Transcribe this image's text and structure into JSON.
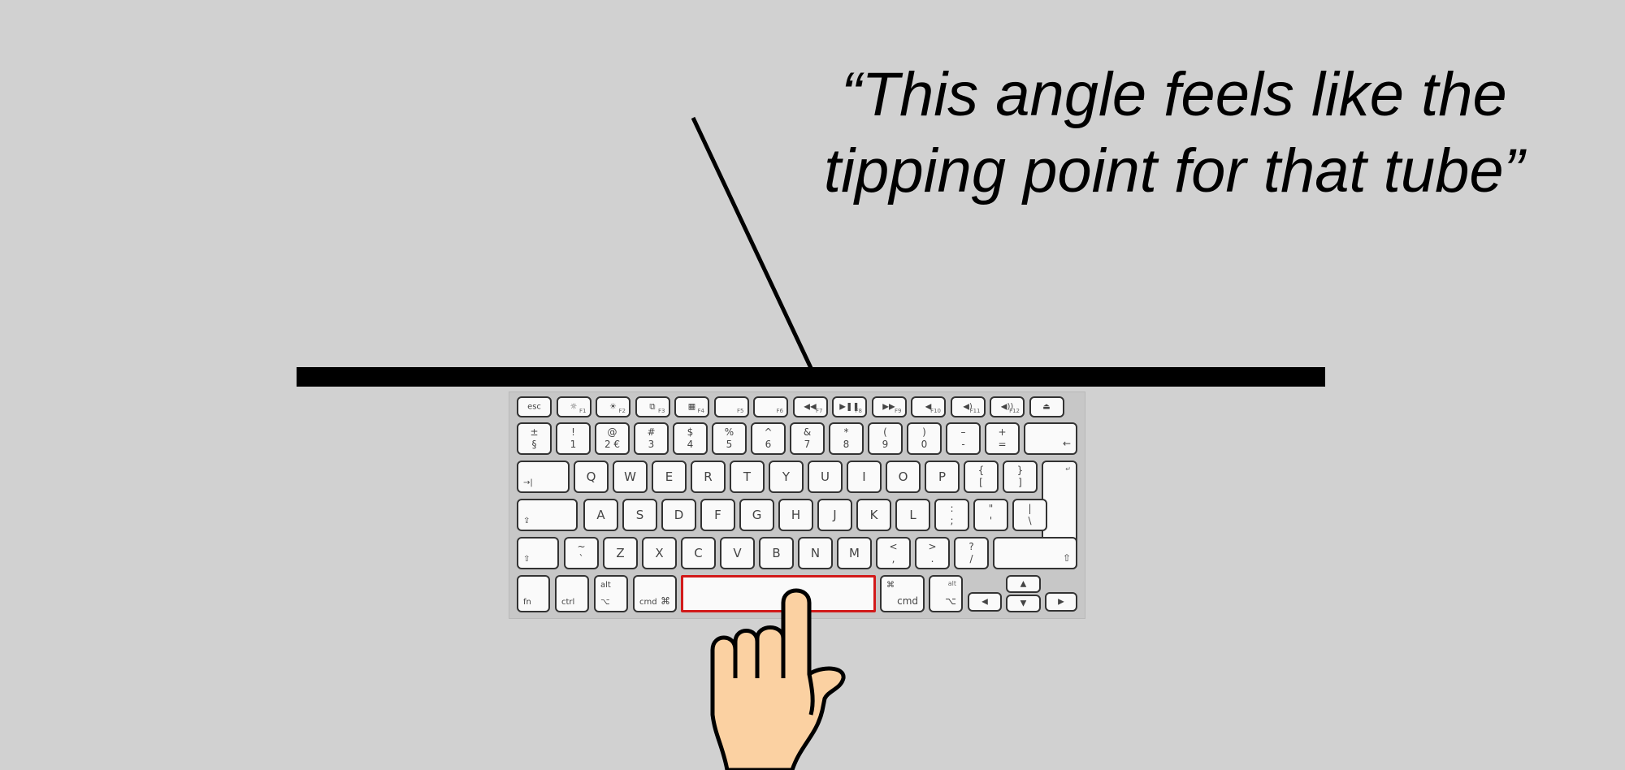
{
  "quote": {
    "line1": "“This angle feels like the",
    "line2": "tipping point for that tube”"
  },
  "keyboard": {
    "fkeys": [
      {
        "c": "esc",
        "fn": ""
      },
      {
        "c": "☼",
        "fn": "F1"
      },
      {
        "c": "☀",
        "fn": "F2"
      },
      {
        "c": "⧉",
        "fn": "F3"
      },
      {
        "c": "▦",
        "fn": "F4"
      },
      {
        "c": "",
        "fn": "F5"
      },
      {
        "c": "",
        "fn": "F6"
      },
      {
        "c": "◀◀",
        "fn": "F7"
      },
      {
        "c": "▶❚❚",
        "fn": "F8"
      },
      {
        "c": "▶▶",
        "fn": "F9"
      },
      {
        "c": "◀",
        "fn": "F10"
      },
      {
        "c": "◀)",
        "fn": "F11"
      },
      {
        "c": "◀))",
        "fn": "F12"
      },
      {
        "c": "⏏",
        "fn": ""
      }
    ],
    "numrow": [
      {
        "t": "±",
        "b": "§"
      },
      {
        "t": "!",
        "b": "1"
      },
      {
        "t": "@",
        "b": "2 €"
      },
      {
        "t": "#",
        "b": "3"
      },
      {
        "t": "$",
        "b": "4"
      },
      {
        "t": "%",
        "b": "5"
      },
      {
        "t": "^",
        "b": "6"
      },
      {
        "t": "&",
        "b": "7"
      },
      {
        "t": "*",
        "b": "8"
      },
      {
        "t": "(",
        "b": "9"
      },
      {
        "t": ")",
        "b": "0"
      },
      {
        "t": "–",
        "b": "-"
      },
      {
        "t": "+",
        "b": "="
      }
    ],
    "backspace": "←",
    "tab": "→|",
    "qrow": [
      {
        "c": "Q"
      },
      {
        "c": "W"
      },
      {
        "c": "E"
      },
      {
        "c": "R"
      },
      {
        "c": "T"
      },
      {
        "c": "Y"
      },
      {
        "c": "U"
      },
      {
        "c": "I"
      },
      {
        "c": "O"
      },
      {
        "c": "P"
      },
      {
        "t": "{",
        "b": "["
      },
      {
        "t": "}",
        "b": "]"
      }
    ],
    "enter": "↵",
    "caps": "⇪",
    "arow": [
      {
        "c": "A"
      },
      {
        "c": "S"
      },
      {
        "c": "D"
      },
      {
        "c": "F"
      },
      {
        "c": "G"
      },
      {
        "c": "H"
      },
      {
        "c": "J"
      },
      {
        "c": "K"
      },
      {
        "c": "L"
      },
      {
        "t": ":",
        "b": ";"
      },
      {
        "t": "\"",
        "b": "'"
      },
      {
        "t": "|",
        "b": "\\"
      }
    ],
    "shift_left": "⇧",
    "zrow": [
      {
        "t": "~",
        "b": "`"
      },
      {
        "c": "Z"
      },
      {
        "c": "X"
      },
      {
        "c": "C"
      },
      {
        "c": "V"
      },
      {
        "c": "B"
      },
      {
        "c": "N"
      },
      {
        "c": "M"
      },
      {
        "t": "<",
        "b": ","
      },
      {
        "t": ">",
        "b": "."
      },
      {
        "t": "?",
        "b": "/"
      }
    ],
    "shift_right": "⇧",
    "bottom": {
      "fn": "fn",
      "ctrl": "ctrl",
      "alt_top": "alt",
      "alt_sym": "⌥",
      "cmd": "cmd",
      "cmd_sym": "⌘",
      "arrow_up": "▲",
      "arrow_down": "▼",
      "arrow_left": "◀",
      "arrow_right": "▶"
    },
    "highlight_color": "#d21a1a"
  },
  "scene": {
    "bar_color": "#000000",
    "hand_fill": "#fbd1a2"
  }
}
